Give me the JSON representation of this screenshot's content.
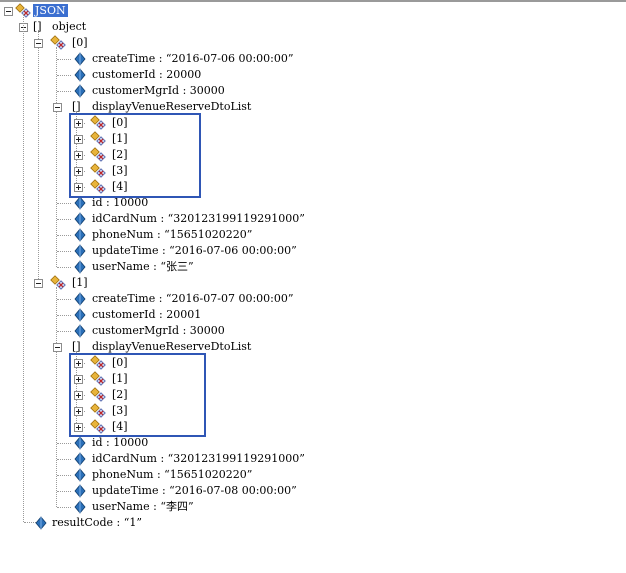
{
  "tree": {
    "root_label": "JSON",
    "object_label": "object",
    "nodes": [
      {
        "index_label": "[0]",
        "createTime": "createTime : “2016-07-06 00:00:00”",
        "customerId": "customerId : 20000",
        "customerMgrId": "customerMgrId : 30000",
        "list_label": "displayVenueReserveDtoList",
        "list_items": [
          "[0]",
          "[1]",
          "[2]",
          "[3]",
          "[4]"
        ],
        "id": "id : 10000",
        "idCardNum": "idCardNum : “320123199119291000”",
        "phoneNum": "phoneNum : “15651020220”",
        "updateTime": "updateTime : “2016-07-06 00:00:00”",
        "userName": "userName : “张三”"
      },
      {
        "index_label": "[1]",
        "createTime": "createTime : “2016-07-07 00:00:00”",
        "customerId": "customerId : 20001",
        "customerMgrId": "customerMgrId : 30000",
        "list_label": "displayVenueReserveDtoList",
        "list_items": [
          "[0]",
          "[1]",
          "[2]",
          "[3]",
          "[4]"
        ],
        "id": "id : 10000",
        "idCardNum": "idCardNum : “320123199119291000”",
        "phoneNum": "phoneNum : “15651020220”",
        "updateTime": "updateTime : “2016-07-08 00:00:00”",
        "userName": "userName : “李四”"
      }
    ],
    "resultCode": "resultCode : “1”"
  },
  "colors": {
    "selection": "#3b6fd0",
    "highlight_box": "#2f56b5",
    "value_icon": "#2a6fb8",
    "object_icon_gold": "#e8b43a"
  },
  "icons": {
    "object": "json-object-icon",
    "array": "array-brackets-icon",
    "value": "value-diamond-icon",
    "expander": "expander-box-icon"
  }
}
